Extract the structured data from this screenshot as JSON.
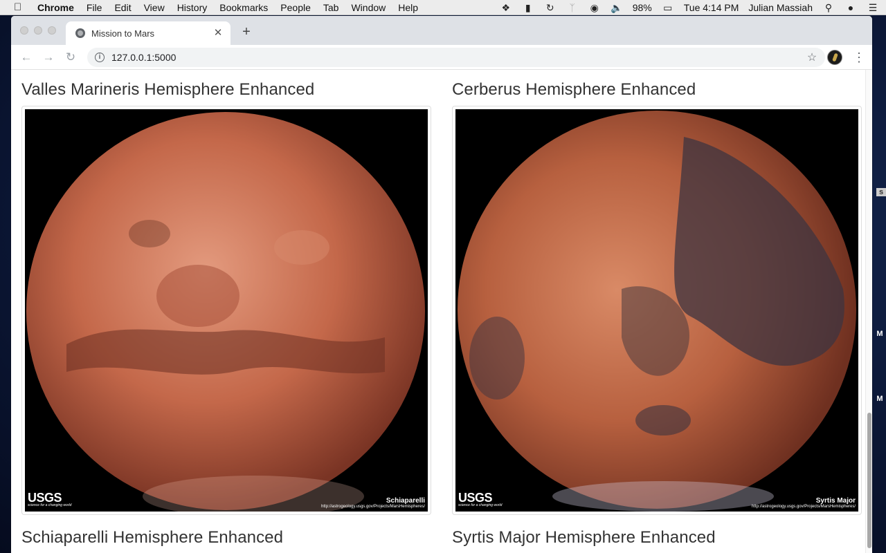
{
  "menubar": {
    "app_name": "Chrome",
    "menus": [
      "File",
      "Edit",
      "View",
      "History",
      "Bookmarks",
      "People",
      "Tab",
      "Window",
      "Help"
    ],
    "battery": "98%",
    "clock": "Tue 4:14 PM",
    "user": "Julian Massiah"
  },
  "browser": {
    "tab_title": "Mission to Mars",
    "url": "127.0.0.1:5000"
  },
  "hemispheres": [
    {
      "title": "Valles Marineris Hemisphere Enhanced",
      "image_label": "Schiaparelli",
      "image_url_text": "http://astrogeology.usgs.gov/Projects/MarsHemispheres/",
      "logo": "USGS",
      "logo_tagline": "science for a changing world"
    },
    {
      "title": "Cerberus Hemisphere Enhanced",
      "image_label": "Syrtis Major",
      "image_url_text": "http://astrogeology.usgs.gov/Projects/MarsHemispheres/",
      "logo": "USGS",
      "logo_tagline": "science for a changing world"
    },
    {
      "title": "Schiaparelli Hemisphere Enhanced"
    },
    {
      "title": "Syrtis Major Hemisphere Enhanced"
    }
  ],
  "desktop": {
    "edge_chips": [
      "s",
      "M",
      "M"
    ]
  },
  "colors": {
    "mars_light": "#e39a7e",
    "mars_mid": "#b5593d",
    "mars_dark": "#5c2a1e",
    "mars_shadow": "#3d3440",
    "page_text": "#333333"
  }
}
